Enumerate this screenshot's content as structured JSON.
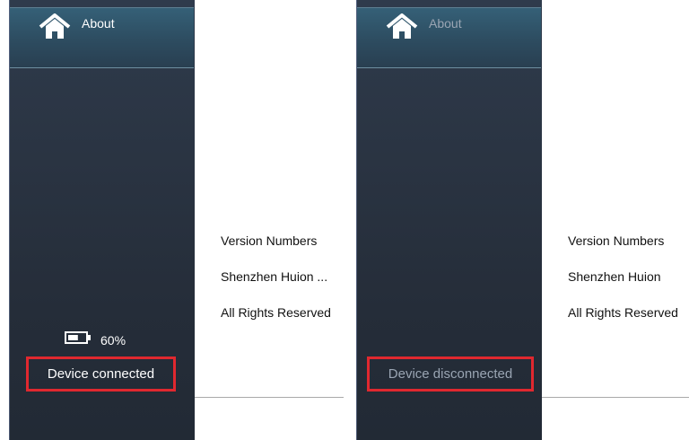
{
  "left_panel": {
    "nav_about_label": "About",
    "battery_percent": "60%",
    "battery_level": 0.6,
    "status": "Device connected",
    "info_lines": [
      "Version Numbers",
      "Shenzhen Huion ...",
      "All Rights Reserved"
    ]
  },
  "right_panel": {
    "nav_about_label": "About",
    "status": "Device disconnected",
    "info_lines": [
      "Version Numbers",
      "Shenzhen Huion",
      "All Rights Reserved"
    ]
  },
  "colors": {
    "sidebar": "#252d39",
    "nav_highlight": "#2d4c60",
    "highlight_box": "#e0282f",
    "text_active": "#ffffff",
    "text_muted": "#9aa5b3"
  },
  "icons": [
    "home-icon",
    "battery-icon"
  ]
}
